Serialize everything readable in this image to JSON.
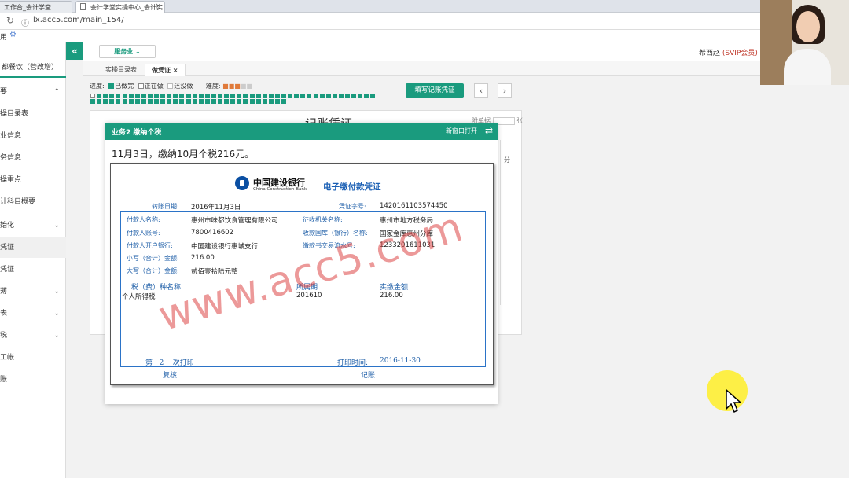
{
  "browser": {
    "tabs": [
      {
        "label": "工作台_会计学堂"
      },
      {
        "label": "会计学堂实操中心_会计实"
      }
    ],
    "url": "lx.acc5.com/main_154/"
  },
  "sidebar": {
    "company": "都餐饮（营改增）",
    "items": [
      {
        "label": "要"
      },
      {
        "label": "操目录表"
      },
      {
        "label": "业信息"
      },
      {
        "label": "务信息"
      },
      {
        "label": "操重点"
      },
      {
        "label": "计科目概要"
      },
      {
        "label": "始化"
      },
      {
        "label": "凭证"
      },
      {
        "label": "凭证"
      },
      {
        "label": "薄"
      },
      {
        "label": "表"
      },
      {
        "label": "税"
      },
      {
        "label": "工帐"
      },
      {
        "label": "账"
      }
    ]
  },
  "topbar": {
    "service_select": "服务业",
    "user_name": "希西赵",
    "user_vip": "(SVIP会员)"
  },
  "page_tabs": [
    {
      "label": "实操目录表"
    },
    {
      "label": "做凭证"
    }
  ],
  "progress": {
    "label": "进度:",
    "done": "已做完",
    "doing": "正在做",
    "todo": "还没做",
    "difficulty_label": "难度:",
    "fill_button": "填写记账凭证"
  },
  "voucher_bg": {
    "title": "记账凭证",
    "attachments": "附单据",
    "unit": "张",
    "fen": "分"
  },
  "modal": {
    "title": "业务2 缴纳个税",
    "open_new_window": "新窗口打开",
    "task_text": "11月3日，缴纳10月个税216元。"
  },
  "receipt": {
    "bank_cn": "中国建设银行",
    "bank_en": "China Construction Bank",
    "title": "电子缴付款凭证",
    "transfer_date_label": "转账日期:",
    "transfer_date": "2016年11月3日",
    "voucher_no_label": "凭证字号:",
    "voucher_no": "1420161103574450",
    "payer_name_label": "付款人名称:",
    "payer_name": "惠州市味都饮食管理有限公司",
    "collector_label": "征收机关名称:",
    "collector": "惠州市地方税务局",
    "payer_account_label": "付款人账号:",
    "payer_account": "7800416602",
    "treasury_label": "收款国库（银行）名称:",
    "treasury": "国家金库惠州分库",
    "payer_bank_label": "付款人开户银行:",
    "payer_bank": "中国建设银行惠城支行",
    "serial_label": "缴款书交易流水号:",
    "serial": "1233201611031",
    "small_amount_label": "小写（合计）金额:",
    "small_amount": "216.00",
    "big_amount_label": "大写（合计）金额:",
    "big_amount": "贰佰壹拾陆元整",
    "tax_type_header": "税（费）种名称",
    "period_header": "所属期",
    "paid_header": "实缴金额",
    "tax_type": "个人所得税",
    "period": "201610",
    "paid": "216.00",
    "print_count_prefix": "第",
    "print_count": "2",
    "print_count_suffix": "次打印",
    "print_time_label": "打印时间:",
    "print_time": "2016-11-30",
    "review_label": "复核",
    "bookkeeping_label": "记账",
    "watermark": "www.acc5.com"
  }
}
